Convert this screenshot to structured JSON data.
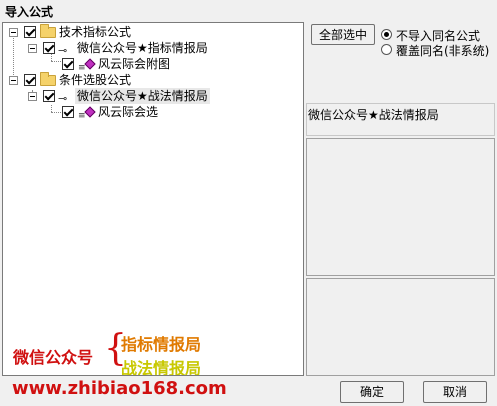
{
  "window": {
    "title": "导入公式"
  },
  "tree": {
    "nodes": [
      {
        "label": "技术指标公式"
      },
      {
        "label": "微信公众号★指标情报局"
      },
      {
        "label": "风云际会附图"
      },
      {
        "label": "条件选股公式"
      },
      {
        "label": "微信公众号★战法情报局"
      },
      {
        "label": "风云际会选"
      }
    ]
  },
  "controls": {
    "select_all": "全部选中",
    "radio_no_import": "不导入同名公式",
    "radio_overwrite": "覆盖同名(非系统)",
    "ok": "确定",
    "cancel": "取消"
  },
  "details": {
    "selected_name": "微信公众号★战法情报局"
  },
  "watermark": {
    "left": "微信公众号",
    "line1": "指标情报局",
    "line2": "战法情报局",
    "url": "www.zhibiao168.com",
    "brace": "{"
  },
  "colors": {
    "watermark_red": "#d01010",
    "watermark_orange": "#e07a00",
    "watermark_yellow": "#c8c800"
  }
}
